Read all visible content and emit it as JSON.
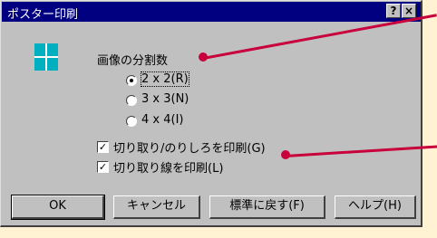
{
  "window": {
    "title": "ポスター印刷"
  },
  "titlebar": {
    "help_label": "?",
    "close_label": "×"
  },
  "section": {
    "label": "画像の分割数"
  },
  "radios": [
    {
      "label": "2 x 2(R)",
      "selected": true
    },
    {
      "label": "3 x 3(N)",
      "selected": false
    },
    {
      "label": "4 x 4(I)",
      "selected": false
    }
  ],
  "checkboxes": [
    {
      "label": "切り取り/のりしろを印刷(G)",
      "checked": true
    },
    {
      "label": "切り取り線を印刷(L)",
      "checked": true
    }
  ],
  "buttons": {
    "ok": "OK",
    "cancel": "キャンセル",
    "default": "標準に戻す(F)",
    "help": "ヘルプ(H)"
  },
  "colors": {
    "callout": "#c8003c",
    "titlebar": "#000080",
    "background": "#fff3d3"
  }
}
